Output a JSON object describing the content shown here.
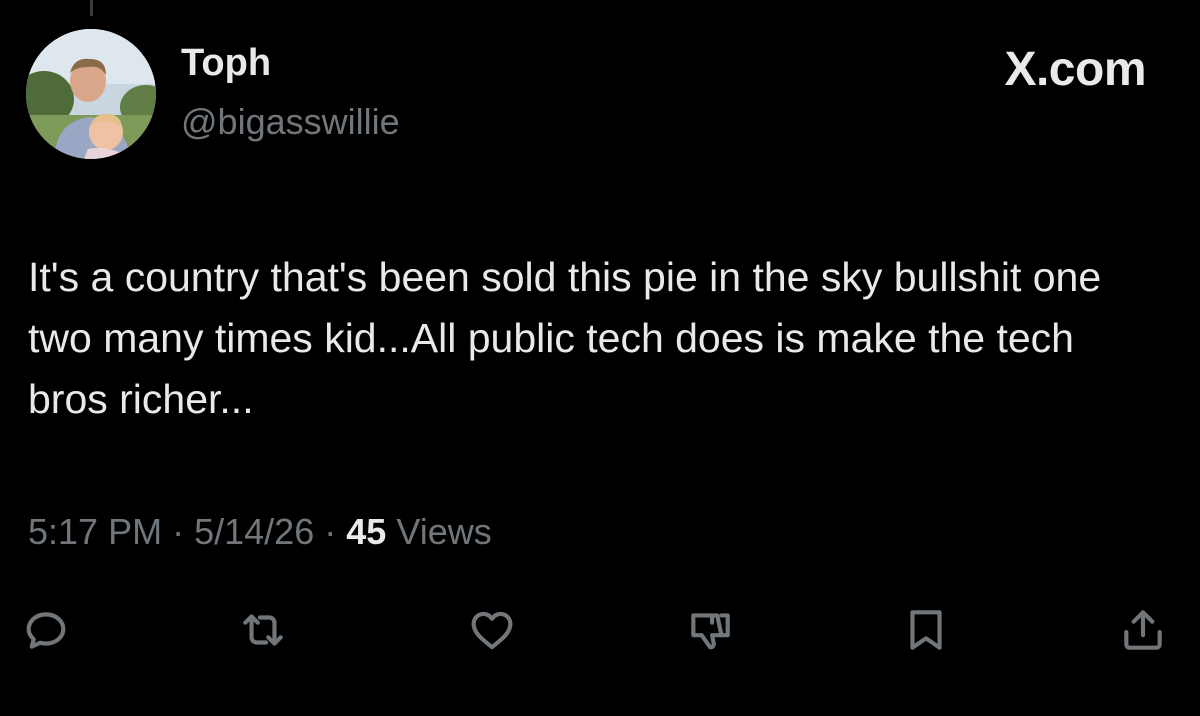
{
  "author": {
    "name": "Toph",
    "handle": "@bigasswillie",
    "avatar_icon": "profile-photo"
  },
  "brand": {
    "label": "X.com"
  },
  "tweet": {
    "text": "It's a country that's been sold this pie in the sky bullshit one two many times kid...All public tech does is make the tech bros richer..."
  },
  "meta": {
    "time": "5:17 PM",
    "separator": "·",
    "date": "5/14/26",
    "views_count": "45",
    "views_label": "Views"
  },
  "actions": [
    {
      "name": "reply",
      "icon": "reply-icon"
    },
    {
      "name": "repost",
      "icon": "repost-icon"
    },
    {
      "name": "like",
      "icon": "heart-icon"
    },
    {
      "name": "dislike",
      "icon": "thumbs-down-icon"
    },
    {
      "name": "bookmark",
      "icon": "bookmark-icon"
    },
    {
      "name": "share",
      "icon": "share-icon"
    }
  ],
  "colors": {
    "background": "#000000",
    "primary_text": "#e7e9ea",
    "secondary_text": "#71767b"
  }
}
